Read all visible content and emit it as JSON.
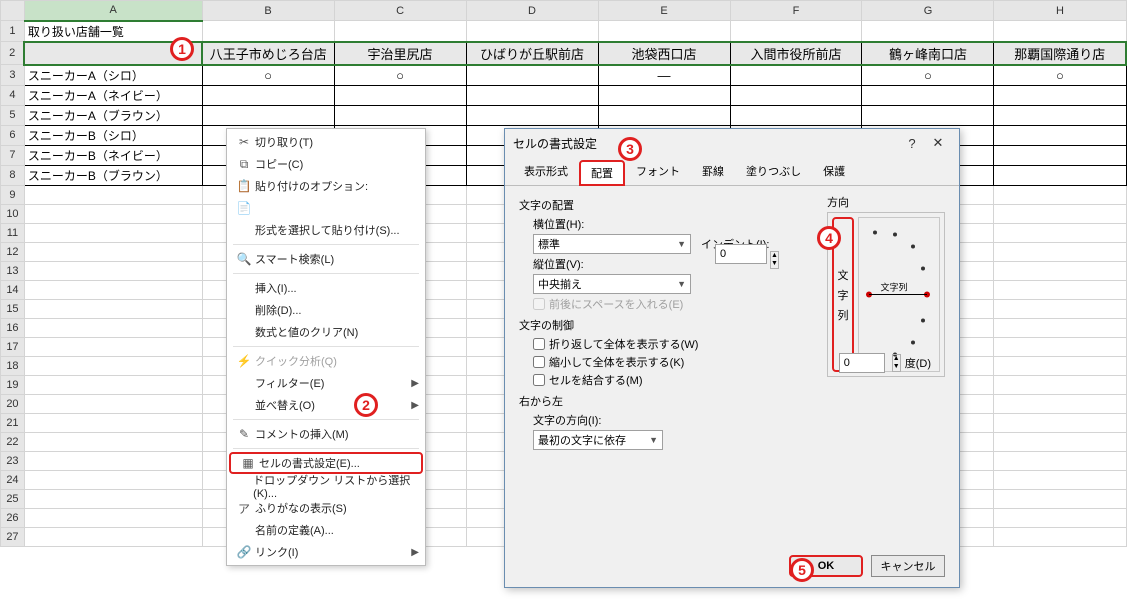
{
  "sheet": {
    "columns": [
      "A",
      "B",
      "C",
      "D",
      "E",
      "F",
      "G",
      "H"
    ],
    "rows": [
      "1",
      "2",
      "3",
      "4",
      "5",
      "6",
      "7",
      "8",
      "9",
      "10",
      "11",
      "12",
      "13",
      "14",
      "15",
      "16",
      "17",
      "18",
      "19",
      "20",
      "21",
      "22",
      "23",
      "24",
      "25",
      "26",
      "27"
    ],
    "a1": "取り扱い店舗一覧",
    "headerRow": [
      "",
      "八王子市めじろ台店",
      "宇治里尻店",
      "ひばりが丘駅前店",
      "池袋西口店",
      "入間市役所前店",
      "鶴ヶ峰南口店",
      "那覇国際通り店"
    ],
    "dataRows": [
      [
        "スニーカーA（シロ）",
        "○",
        "○",
        "",
        "—",
        "",
        "○",
        "○"
      ],
      [
        "スニーカーA（ネイビー）",
        "",
        "",
        "",
        "",
        "",
        "",
        ""
      ],
      [
        "スニーカーA（ブラウン）",
        "",
        "",
        "",
        "",
        "",
        "",
        ""
      ],
      [
        "スニーカーB（シロ）",
        "",
        "",
        "",
        "",
        "",
        "",
        ""
      ],
      [
        "スニーカーB（ネイビー）",
        "",
        "",
        "",
        "",
        "",
        "",
        ""
      ],
      [
        "スニーカーB（ブラウン）",
        "",
        "",
        "",
        "",
        "",
        "",
        ""
      ]
    ]
  },
  "context_menu": {
    "items": [
      {
        "icon": "✂",
        "label": "切り取り(T)"
      },
      {
        "icon": "⧉",
        "label": "コピー(C)"
      },
      {
        "icon": "📋",
        "label": "貼り付けのオプション:"
      },
      {
        "icon": "📄",
        "label": ""
      },
      {
        "icon": "",
        "label": "形式を選択して貼り付け(S)...",
        "sep_after": true
      },
      {
        "icon": "🔍",
        "label": "スマート検索(L)",
        "sep_after": true
      },
      {
        "icon": "",
        "label": "挿入(I)..."
      },
      {
        "icon": "",
        "label": "削除(D)..."
      },
      {
        "icon": "",
        "label": "数式と値のクリア(N)",
        "sep_after": true
      },
      {
        "icon": "⚡",
        "label": "クイック分析(Q)",
        "disabled": true
      },
      {
        "icon": "",
        "label": "フィルター(E)",
        "arrow": true
      },
      {
        "icon": "",
        "label": "並べ替え(O)",
        "arrow": true,
        "sep_after": true
      },
      {
        "icon": "✎",
        "label": "コメントの挿入(M)",
        "sep_after": true
      },
      {
        "icon": "▦",
        "label": "セルの書式設定(E)...",
        "highlight": true
      },
      {
        "icon": "",
        "label": "ドロップダウン リストから選択(K)..."
      },
      {
        "icon": "ア",
        "label": "ふりがなの表示(S)"
      },
      {
        "icon": "",
        "label": "名前の定義(A)..."
      },
      {
        "icon": "🔗",
        "label": "リンク(I)",
        "arrow": true
      }
    ]
  },
  "dialog": {
    "title": "セルの書式設定",
    "help": "?",
    "close": "✕",
    "tabs": [
      "表示形式",
      "配置",
      "フォント",
      "罫線",
      "塗りつぶし",
      "保護"
    ],
    "active_tab": 1,
    "sections": {
      "text_align": "文字の配置",
      "h_label": "横位置(H):",
      "h_value": "標準",
      "indent_label": "インデント(I):",
      "indent_value": "0",
      "v_label": "縦位置(V):",
      "v_value": "中央揃え",
      "space_label": "前後にスペースを入れる(E)",
      "text_control": "文字の制御",
      "wrap": "折り返して全体を表示する(W)",
      "shrink": "縮小して全体を表示する(K)",
      "merge": "セルを結合する(M)",
      "rtl": "右から左",
      "dir_label": "文字の方向(I):",
      "dir_value": "最初の文字に依存"
    },
    "orientation": {
      "label": "方向",
      "vert_text": "文字列",
      "clock_text": "文字列",
      "degree_value": "0",
      "degree_label": "度(D)"
    },
    "buttons": {
      "ok": "OK",
      "cancel": "キャンセル"
    }
  },
  "callouts": {
    "1": "1",
    "2": "2",
    "3": "3",
    "4": "4",
    "5": "5"
  }
}
